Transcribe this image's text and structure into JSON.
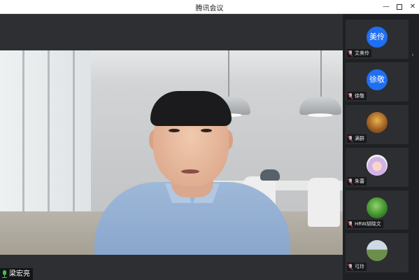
{
  "window": {
    "title": "腾讯会议",
    "controls": {
      "minimize": "—",
      "close": "✕"
    }
  },
  "speaker": {
    "name": "梁宏亮",
    "mic_state": "active"
  },
  "participants": [
    {
      "name": "艾美伶",
      "avatar_type": "text",
      "avatar_text": "美伶",
      "avatar_color": "#1f6ff2",
      "mic": "muted"
    },
    {
      "name": "徐敬",
      "avatar_type": "text",
      "avatar_text": "徐敬",
      "avatar_color": "#1f6ff2",
      "mic": "muted"
    },
    {
      "name": "满群",
      "avatar_type": "photo",
      "photo": "autumn-tree",
      "mic": "muted"
    },
    {
      "name": "朱蕾",
      "avatar_type": "photo",
      "photo": "cartoon-character",
      "mic": "muted"
    },
    {
      "name": "HRW胡晓文",
      "avatar_type": "photo",
      "photo": "green-leaves",
      "mic": "muted"
    },
    {
      "name": "弓玲",
      "avatar_type": "photo",
      "photo": "field-landscape",
      "mic": "muted"
    }
  ],
  "colors": {
    "accent_avatar": "#1f6ff2",
    "mic_active": "#3bc24b",
    "mic_muted_slash": "#e04848",
    "background": "#2a2c30"
  }
}
